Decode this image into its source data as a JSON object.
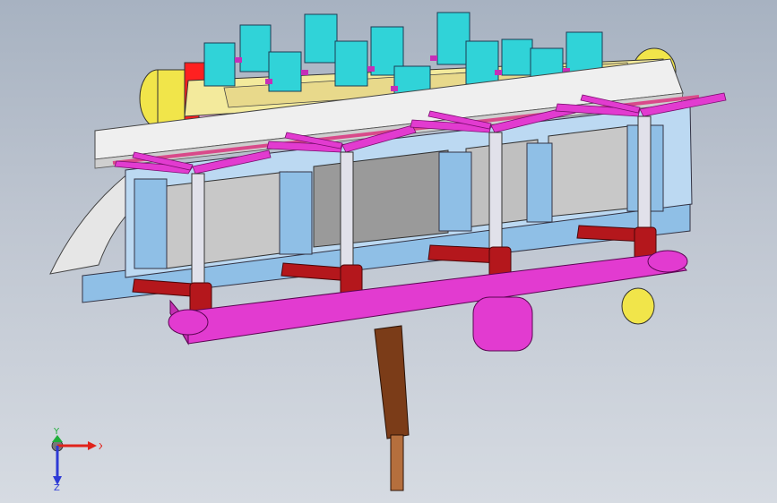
{
  "viewport": {
    "background_top": "#a7b2c1",
    "background_bottom": "#d6dbe2"
  },
  "triad": {
    "x_label": "X",
    "y_label": "Y",
    "z_label": "Z",
    "x_color": "#e0231b",
    "y_color": "#1fae3a",
    "z_color": "#2d3ad6"
  },
  "model": {
    "name": "",
    "colors": {
      "frame_blue": "#8fbfe6",
      "arm_magenta": "#e23bd0",
      "lever_red": "#b4171c",
      "connector_cyan": "#30d3d8",
      "motor_yellow": "#f1e54a",
      "plate_white": "#efefef",
      "rod_brown": "#7b3c18",
      "rail_pink": "#d94a8a"
    },
    "stations": 4
  }
}
